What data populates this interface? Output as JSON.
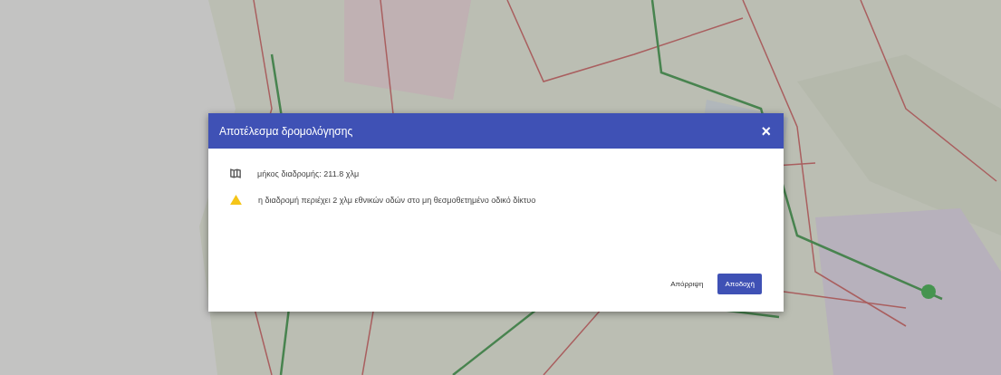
{
  "dialog": {
    "title": "Αποτέλεσμα δρομολόγησης",
    "close": "×",
    "messages": [
      {
        "kind": "info",
        "text": "μήκος διαδρομής: 211.8 χλμ"
      },
      {
        "kind": "warning",
        "text": "η διαδρομή περιέχει 2 χλμ εθνικών οδών στο μη θεσμοθετημένο οδικό δίκτυο"
      }
    ],
    "buttons": [
      {
        "label": "Απόρριψη",
        "kind": "text"
      },
      {
        "label": "Αποδοχή",
        "kind": "primary"
      }
    ]
  }
}
